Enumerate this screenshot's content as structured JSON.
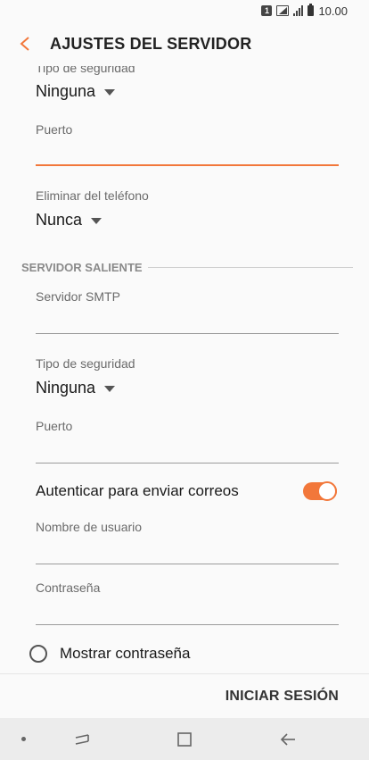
{
  "status_bar": {
    "sim_label": "1",
    "time": "10.00"
  },
  "app_bar": {
    "title": "AJUSTES DEL SERVIDOR"
  },
  "incoming": {
    "security_label": "Tipo de seguridad",
    "security_value": "Ninguna",
    "port_label": "Puerto",
    "port_value": "",
    "delete_label": "Eliminar del teléfono",
    "delete_value": "Nunca"
  },
  "outgoing": {
    "section_title": "SERVIDOR SALIENTE",
    "smtp_label": "Servidor SMTP",
    "smtp_value": "",
    "security_label": "Tipo de seguridad",
    "security_value": "Ninguna",
    "port_label": "Puerto",
    "port_value": "",
    "auth_label": "Autenticar para enviar correos",
    "auth_enabled": true,
    "username_label": "Nombre de usuario",
    "username_value": "",
    "password_label": "Contraseña",
    "password_value": "",
    "show_password_label": "Mostrar contraseña"
  },
  "footer": {
    "signin_label": "INICIAR SESIÓN"
  },
  "colors": {
    "accent": "#f2773a",
    "background": "#fafafa",
    "navbar": "#ececec"
  },
  "icons": [
    "back-arrow-icon",
    "recent-apps-icon",
    "home-icon",
    "back-icon"
  ]
}
